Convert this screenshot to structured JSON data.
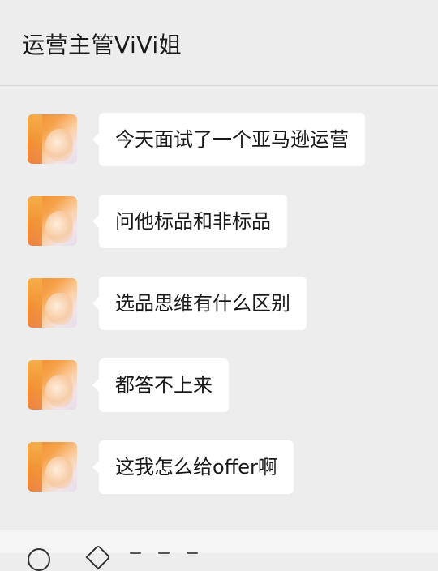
{
  "header": {
    "title": "运营主管ViVi姐"
  },
  "messages": [
    {
      "text": "今天面试了一个亚马逊运营"
    },
    {
      "text": "问他标品和非标品"
    },
    {
      "text": "选品思维有什么区别"
    },
    {
      "text": "都答不上来"
    },
    {
      "text": "这我怎么给offer啊"
    }
  ],
  "footer": {
    "icons": [
      "voice-icon",
      "emoji-icon",
      "more-icon"
    ]
  },
  "colors": {
    "background": "#ededed",
    "bubble": "#ffffff",
    "text": "#1a1a1a",
    "avatar_accent": "#f08a2c"
  }
}
